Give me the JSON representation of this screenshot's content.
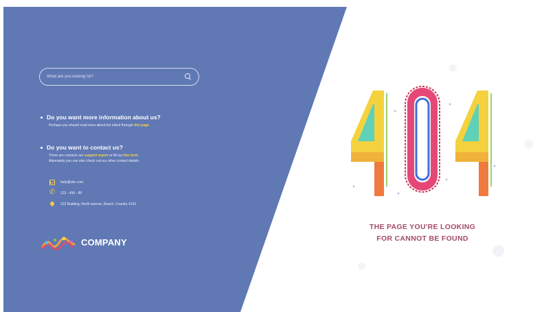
{
  "search": {
    "placeholder": "What are you looking for?"
  },
  "info": {
    "q1_title": "Do you want more information about us?",
    "q1_text_before": "Perhaps you should read more about the intent through ",
    "q1_link": "this page",
    "q2_title": "Do you want to contact us?",
    "q2_text_line1_before": "There are contacts our ",
    "q2_link1": "support expert",
    "q2_text_mid": " or fill our ",
    "q2_link2": "this form",
    "q2_text_line2": "Alternately you can also check out our other contact details:"
  },
  "contacts": {
    "email": "help@site.com",
    "phone": "123 - 456 - 89",
    "address": "123 Building, North avenue, Beach, Country 4133"
  },
  "brand": {
    "name": "COMPANY"
  },
  "error": {
    "code": "404",
    "line1": "THE PAGE YOU'RE LOOKING",
    "line2": "FOR CANNOT BE FOUND"
  },
  "colors": {
    "panel": "#6078b4",
    "accent": "#f6d449",
    "message": "#a24a6c"
  }
}
